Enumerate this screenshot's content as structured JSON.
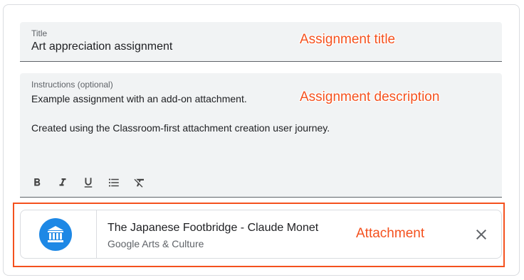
{
  "title_field": {
    "label": "Title",
    "value": "Art appreciation assignment"
  },
  "instructions_field": {
    "label": "Instructions (optional)",
    "value": "Example assignment with an add-on attachment.\n\nCreated using the Classroom-first attachment creation user journey."
  },
  "toolbar": {
    "buttons": [
      "bold-icon",
      "italic-icon",
      "underline-icon",
      "bulleted-list-icon",
      "clear-formatting-icon"
    ]
  },
  "attachment": {
    "title": "The Japanese Footbridge - Claude Monet",
    "subtitle": "Google Arts & Culture",
    "logo_icon": "museum-icon",
    "close_icon": "close-icon"
  },
  "annotations": {
    "title": "Assignment title",
    "description": "Assignment description",
    "attachment": "Attachment",
    "color": "#f4511e"
  },
  "colors": {
    "logo_blue": "#1e88e5",
    "field_bg": "#f1f3f4"
  }
}
